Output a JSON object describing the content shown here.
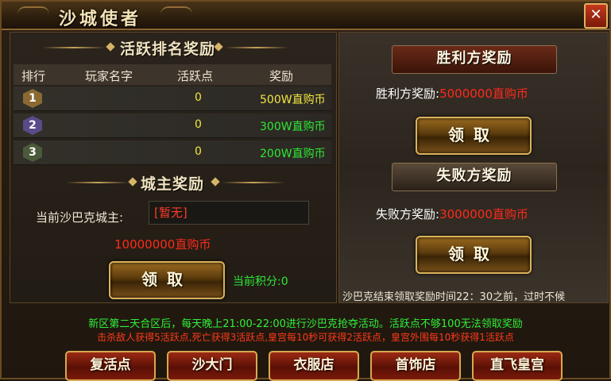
{
  "window": {
    "title": "沙城使者",
    "close_label": "✕"
  },
  "activity": {
    "section_title": "活跃排名奖励",
    "headers": {
      "rank": "排行",
      "player": "玩家名字",
      "points": "活跃点",
      "reward": "奖励"
    },
    "rows": [
      {
        "rank": "1",
        "player": "",
        "points": "0",
        "reward": "500W直购币",
        "badge_color": "#8a6a32",
        "reward_color": "#f2e640"
      },
      {
        "rank": "2",
        "player": "",
        "points": "0",
        "reward": "300W直购币",
        "badge_color": "#5a4a8a",
        "reward_color": "#2ee834"
      },
      {
        "rank": "3",
        "player": "",
        "points": "0",
        "reward": "200W直购币",
        "badge_color": "#4a5a3a",
        "reward_color": "#2ee834"
      }
    ]
  },
  "lord": {
    "section_title": "城主奖励",
    "label": "当前沙巴克城主:",
    "name": "[暂无]",
    "reward": "10000000直购币",
    "claim_label": "领取",
    "points_text": "当前积分:0"
  },
  "winner": {
    "banner": "胜利方奖励",
    "label": "胜利方奖励:",
    "value": "5000000直购币",
    "claim_label": "领取"
  },
  "loser": {
    "banner": "失败方奖励",
    "label": "失败方奖励:",
    "value": "3000000直购币",
    "claim_label": "领取"
  },
  "deadline": "沙巴克结束领取奖励时间22：30之前，过时不候",
  "notices": [
    "新区第二天合区后，每天晚上21:00-22:00进行沙巴克抢夺活动。活跃点不够100无法领取奖励",
    "击杀敌人获得5活跃点,死亡获得3活跃点,皇宫每10秒可获得2活跃点，皇宫外围每10秒获得1活跃点"
  ],
  "nav": [
    "复活点",
    "沙大门",
    "衣服店",
    "首饰店",
    "直飞皇宫"
  ],
  "colors": {
    "accent_gold": "#d9b25a",
    "green_text": "#2ee834",
    "red_text": "#ff2a1a"
  }
}
